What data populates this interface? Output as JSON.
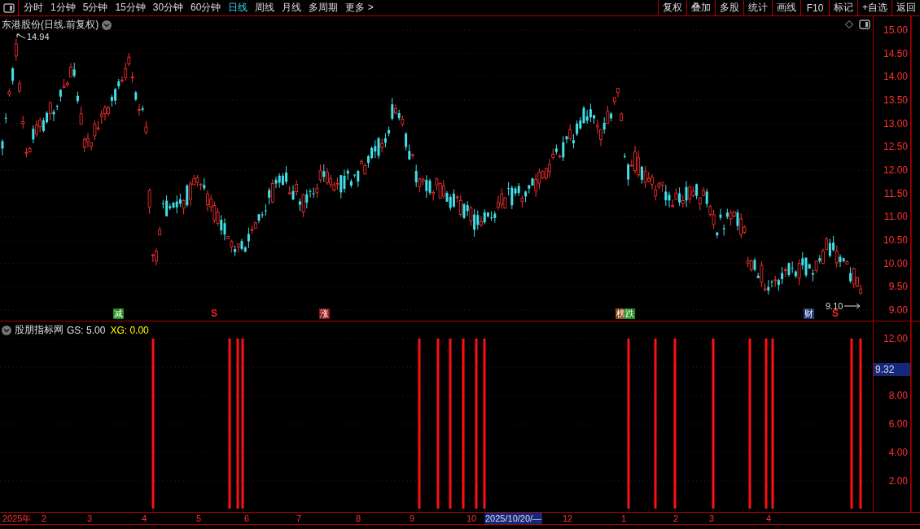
{
  "toolbar": {
    "periods": [
      {
        "label": "分时",
        "selected": false
      },
      {
        "label": "1分钟",
        "selected": false
      },
      {
        "label": "5分钟",
        "selected": false
      },
      {
        "label": "15分钟",
        "selected": false
      },
      {
        "label": "30分钟",
        "selected": false
      },
      {
        "label": "60分钟",
        "selected": false
      },
      {
        "label": "日线",
        "selected": true
      },
      {
        "label": "周线",
        "selected": false
      },
      {
        "label": "月线",
        "selected": false
      },
      {
        "label": "多周期",
        "selected": false
      },
      {
        "label": "更多 >",
        "selected": false
      }
    ],
    "actions": [
      "复权",
      "叠加",
      "多股",
      "统计",
      "画线",
      "F10",
      "标记",
      "+自选",
      "返回"
    ]
  },
  "main_chart": {
    "title": "东港股份(日线.前复权)",
    "high_label": "14.94",
    "low_label": "9.10",
    "price_ticks": [
      "15.00",
      "14.50",
      "14.00",
      "13.50",
      "13.00",
      "12.50",
      "12.00",
      "11.50",
      "11.00",
      "10.50",
      "10.00",
      "9.50",
      "9.00"
    ],
    "markers": [
      {
        "text": "减",
        "kind": "tag",
        "color": "#1e8c1e"
      },
      {
        "text": "S",
        "kind": "signal",
        "color": "#ff2020"
      },
      {
        "text": "涨",
        "kind": "tag",
        "color": "#8c1414"
      },
      {
        "text": "榜",
        "kind": "tag",
        "color": "#8c4a14"
      },
      {
        "text": "跌",
        "kind": "tag",
        "color": "#1e8c1e"
      },
      {
        "text": "财",
        "kind": "tag",
        "color": "#1e3c78"
      },
      {
        "text": "S",
        "kind": "signal",
        "color": "#ff2020"
      }
    ]
  },
  "indicator": {
    "name": "股朋指标网",
    "params": [
      {
        "text": "GS: 5.00",
        "color": "#e0e0e0"
      },
      {
        "text": "XG: 0.00",
        "color": "#ffff00"
      }
    ],
    "ticks": [
      "12.00",
      "8.00",
      "6.00",
      "4.00",
      "2.00"
    ],
    "cursor_value": "9.32"
  },
  "date_axis": {
    "labels": [
      {
        "text": "2025年",
        "selected": false
      },
      {
        "text": "2",
        "selected": false
      },
      {
        "text": "3",
        "selected": false
      },
      {
        "text": "4",
        "selected": false
      },
      {
        "text": "5",
        "selected": false
      },
      {
        "text": "6",
        "selected": false
      },
      {
        "text": "7",
        "selected": false
      },
      {
        "text": "8",
        "selected": false
      },
      {
        "text": "9",
        "selected": false
      },
      {
        "text": "10",
        "selected": false
      },
      {
        "text": "2025/10/20/—",
        "selected": true
      },
      {
        "text": "12",
        "selected": false
      },
      {
        "text": "1",
        "selected": false
      },
      {
        "text": "2",
        "selected": false
      },
      {
        "text": "3",
        "selected": false
      },
      {
        "text": "4",
        "selected": false
      }
    ]
  }
}
